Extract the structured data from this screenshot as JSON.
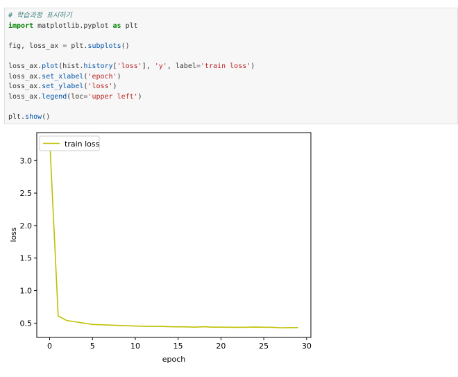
{
  "code_cell": {
    "lines": [
      "# 학습과정 표시하기",
      "import matplotlib.pyplot as plt",
      "",
      "fig, loss_ax = plt.subplots()",
      "",
      "loss_ax.plot(hist.history['loss'], 'y', label='train loss')",
      "loss_ax.set_xlabel('epoch')",
      "loss_ax.set_ylabel('loss')",
      "loss_ax.legend(loc='upper left')",
      "",
      "plt.show()"
    ]
  },
  "chart_data": {
    "type": "line",
    "xlabel": "epoch",
    "ylabel": "loss",
    "xlim": [
      -1.5,
      30.5
    ],
    "ylim": [
      0.28,
      3.43
    ],
    "xticks": [
      0,
      5,
      10,
      15,
      20,
      25,
      30
    ],
    "yticks": [
      0.5,
      1.0,
      1.5,
      2.0,
      2.5,
      3.0
    ],
    "ytick_labels": [
      "0.5",
      "1.0",
      "1.5",
      "2.0",
      "2.5",
      "3.0"
    ],
    "legend_position": "upper left",
    "grid": false,
    "series": [
      {
        "name": "train loss",
        "color": "#bfbf00",
        "x": [
          0,
          1,
          2,
          3,
          4,
          5,
          6,
          7,
          8,
          9,
          10,
          11,
          12,
          13,
          14,
          15,
          16,
          17,
          18,
          19,
          20,
          21,
          22,
          23,
          24,
          25,
          26,
          27,
          28,
          29
        ],
        "y": [
          3.35,
          0.61,
          0.54,
          0.52,
          0.5,
          0.48,
          0.475,
          0.47,
          0.465,
          0.46,
          0.455,
          0.452,
          0.45,
          0.45,
          0.445,
          0.443,
          0.442,
          0.438,
          0.445,
          0.438,
          0.438,
          0.437,
          0.435,
          0.437,
          0.44,
          0.437,
          0.435,
          0.428,
          0.43,
          0.432
        ]
      }
    ]
  }
}
